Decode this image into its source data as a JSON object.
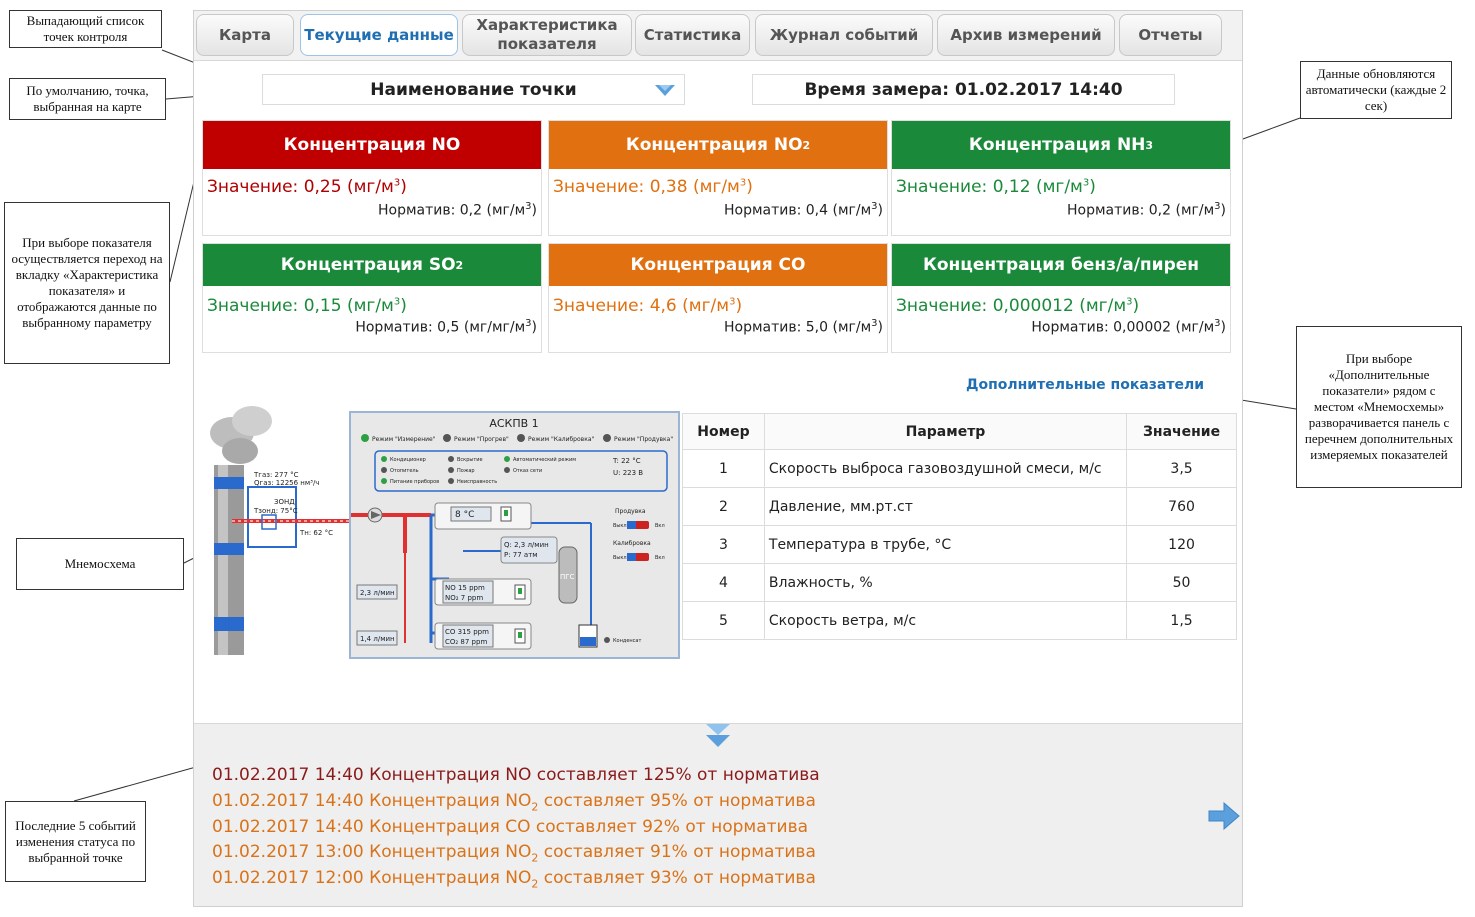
{
  "tabs": [
    {
      "label": "Карта"
    },
    {
      "label": "Текущие данные"
    },
    {
      "label": "Характеристика показателя"
    },
    {
      "label": "Статистика"
    },
    {
      "label": "Журнал событий"
    },
    {
      "label": "Архив измерений"
    },
    {
      "label": "Отчеты"
    }
  ],
  "point_select": {
    "label": "Наименование точки"
  },
  "measure_time": {
    "label": "Время замера: 01.02.2017 14:40"
  },
  "colors": {
    "red": "#c00000",
    "orange": "#e07010",
    "green": "#1a8a3a",
    "accent": "#1f6fb2"
  },
  "cards": [
    {
      "title_prefix": "Концентрация NO",
      "title_sub": "",
      "value_label": "Значение: 0,25 (мг/м",
      "norm_label": "Норматив: 0,2  (мг/м",
      "status": "red"
    },
    {
      "title_prefix": "Концентрация NO",
      "title_sub": "2",
      "value_label": "Значение: 0,38 (мг/м",
      "norm_label": "Норматив: 0,4  (мг/м",
      "status": "orange"
    },
    {
      "title_prefix": "Концентрация NH",
      "title_sub": "3",
      "value_label": "Значение: 0,12 (мг/м",
      "norm_label": "Норматив: 0,2  (мг/м",
      "status": "green"
    },
    {
      "title_prefix": "Концентрация SO",
      "title_sub": "2",
      "value_label": "Значение: 0,15 (мг/м",
      "norm_label": "Норматив: 0,5  (мг/мг/м",
      "status": "green"
    },
    {
      "title_prefix": "Концентрация CO",
      "title_sub": "",
      "value_label": "Значение: 4,6 (мг/м",
      "norm_label": "Норматив: 5,0  (мг/м",
      "status": "orange"
    },
    {
      "title_prefix": "Концентрация бенз/а/пирен",
      "title_sub": "",
      "value_label": "Значение: 0,000012 (мг/м",
      "norm_label": "Норматив: 0,00002  (мг/м",
      "status": "green"
    }
  ],
  "units": {
    "sup": "3",
    "close": ")"
  },
  "extra_link": "Дополнительные показатели",
  "mnemo": {
    "title": "АСКПВ 1",
    "modes": [
      "Режим \"Измерение\"",
      "Режим \"Прогрев\"",
      "Режим \"Калибровка\"",
      "Режим \"Продувка\""
    ],
    "status_items": [
      "Кондиционер",
      "Вскрытие",
      "Автоматический режим",
      "Отопитель",
      "Пожар",
      "Отказ сети",
      "Питание приборов",
      "Неисправность"
    ],
    "t_label": "T: 22 °C",
    "u_label": "U: 223 В",
    "stack_t": "Tгаз: 277 °C",
    "stack_q": "Qгаз: 12256 нм³/ч",
    "probe": "ЗОНД",
    "probe_t": "Tзонд: 75°C",
    "tn": "Tн: 62 °C",
    "dev1": "8 °C",
    "q_p": "Q: 2,3 л/мин",
    "p_p": "P: 77 атм",
    "dev2_no": "NO   15 ppm",
    "dev2_no2": "NO₂    7 ppm",
    "dev3_co": "CO   315 ppm",
    "dev3_co2": "CO₂   87 ppm",
    "flow1": "2,3 л/мин",
    "flow2": "1,4 л/мин",
    "purge": "Продувка",
    "calib": "Калибровка",
    "off": "Выкл",
    "on": "Вкл",
    "pgs": "ПГС",
    "condensate": "Конденсат"
  },
  "params_table": {
    "headers": [
      "Номер",
      "Параметр",
      "Значение"
    ],
    "rows": [
      [
        "1",
        "Скорость выброса газовоздушной смеси, м/с",
        "3,5"
      ],
      [
        "2",
        "Давление, мм.рт.ст",
        "760"
      ],
      [
        "3",
        "Температура в трубе, °С",
        "120"
      ],
      [
        "4",
        "Влажность, %",
        "50"
      ],
      [
        "5",
        "Скорость ветра, м/с",
        "1,5"
      ]
    ]
  },
  "events": [
    {
      "prefix": "01.02.2017 14:40 Концентрация NO",
      "sub": "",
      "suffix": " составляет 125% от норматива",
      "color": "#8b1a1a"
    },
    {
      "prefix": "01.02.2017 14:40 Концентрация NO",
      "sub": "2",
      "suffix": " составляет 95% от норматива",
      "color": "#d9731a"
    },
    {
      "prefix": "01.02.2017 14:40 Концентрация CO",
      "sub": "",
      "suffix": " составляет 92% от норматива",
      "color": "#d9731a"
    },
    {
      "prefix": "01.02.2017 13:00 Концентрация NO",
      "sub": "2",
      "suffix": " составляет 91% от норматива",
      "color": "#d9731a"
    },
    {
      "prefix": "01.02.2017 12:00 Концентрация NO",
      "sub": "2",
      "suffix": " составляет 93% от норматива",
      "color": "#d9731a"
    }
  ],
  "notes": {
    "dropdown": "Выпадающий список точек контроля",
    "default_point": "По умолчанию, точка, выбранная на карте",
    "card_click": "При выборе показателя осуществляется переход на вкладку «Характеристика показателя» и отображаются данные по выбранному параметру",
    "mnemo": "Мнемосхема",
    "events": "Последние 5 событий изменения статуса по выбранной точке",
    "autoupdate": "Данные обновляются автоматически (каждые 2 сек)",
    "extra": "При выборе «Дополнительные показатели» рядом с местом «Мнемосхемы» разворачивается панель с перечнем дополнительных измеряемых показателей"
  }
}
